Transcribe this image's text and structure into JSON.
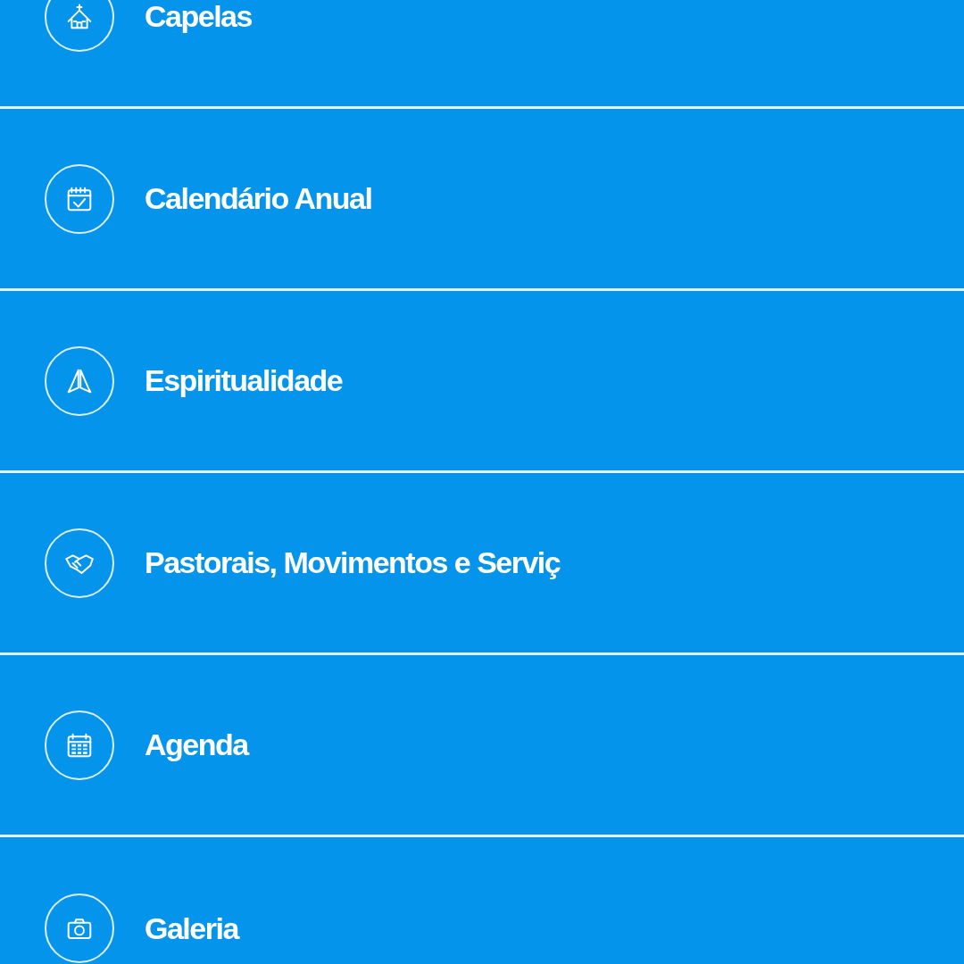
{
  "menu": {
    "items": [
      {
        "label": "Capelas",
        "kind": "chapel"
      },
      {
        "label": "Calendário Anual",
        "kind": "calendar"
      },
      {
        "label": "Espiritualidade",
        "kind": "prayer"
      },
      {
        "label": "Pastorais, Movimentos e Serviç",
        "kind": "ministries"
      },
      {
        "label": "Agenda",
        "kind": "agenda"
      },
      {
        "label": "Galeria",
        "kind": "gallery"
      }
    ]
  }
}
